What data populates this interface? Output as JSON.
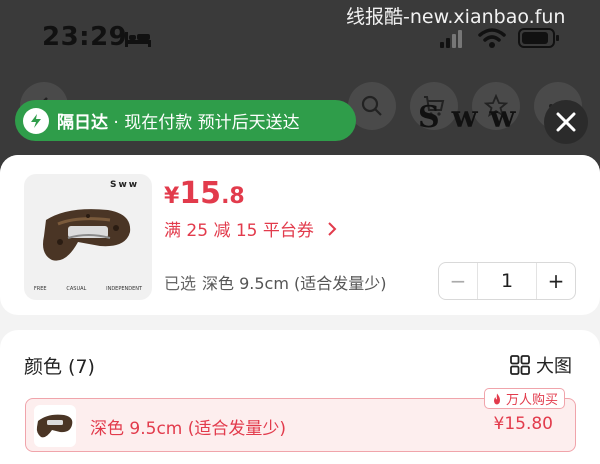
{
  "status_bar": {
    "time": "23:29",
    "watermark": "线报酷-new.xianbao.fun"
  },
  "header": {
    "brand": "Sww"
  },
  "delivery_pill": {
    "tag": "隔日达",
    "message": "· 现在付款 预计后天送达"
  },
  "product": {
    "thumb_brand": "Sww",
    "thumb_footer": [
      "FREE",
      "CASUAL",
      "INDEPENDENT"
    ],
    "price_symbol": "¥",
    "price_int": "15",
    "price_dec": ".8",
    "coupon": "满 25 减 15 平台券",
    "selected_label": "已选",
    "selected_value": "深色 9.5cm (适合发量少)",
    "quantity": "1",
    "minus_label": "−",
    "plus_label": "+"
  },
  "color_section": {
    "title": "颜色 (7)",
    "big_view_label": "大图",
    "badge": "万人购买",
    "options": [
      {
        "label": "深色 9.5cm (适合发量少)",
        "price": "¥15.80"
      }
    ]
  },
  "colors": {
    "accent_red": "#e23b4c",
    "delivery_green": "#2f9d4a"
  }
}
